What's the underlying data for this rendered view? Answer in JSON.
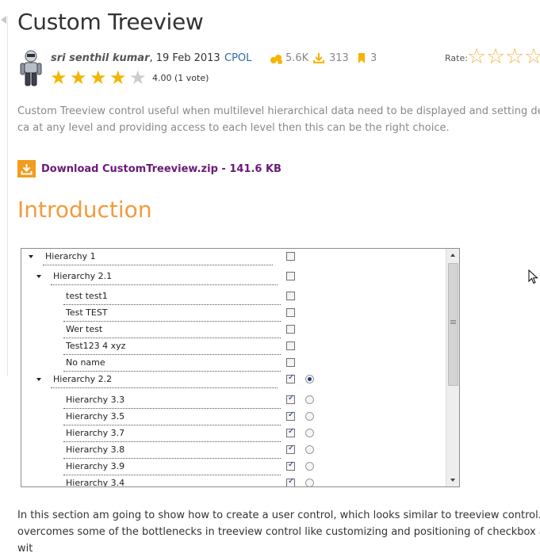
{
  "article": {
    "title": "Custom Treeview",
    "author": "sri senthil kumar",
    "date": ", 19 Feb 2013",
    "license": "CPOL",
    "views": "5.6K",
    "downloads": "313",
    "bookmarks": "3",
    "rating_score": "4.00 (1 vote)",
    "rating_value": 4,
    "rating_max": 5,
    "rate_label": "Rate:",
    "description": "Custom Treeview control useful when multilevel hierarchical data need to be displayed and setting default ca at any level and providing access to each level then this can be the right choice.",
    "download_label": "Download CustomTreeview.zip - 141.6 KB",
    "section_heading": "Introduction",
    "intro_paragraph": "In this section am going to show how to create a user control, which looks similar to treeview control. It overcomes some of the bottlenecks in treeview control like customizing and positioning of checkbox and wit"
  },
  "colors": {
    "accent_orange": "#f29b3d",
    "download_purple": "#6a1a78",
    "link_blue": "#2d6aa1",
    "star_gold": "#f4b400"
  },
  "treeview": {
    "rows": [
      {
        "label": "Hierarchy 1",
        "level": 0,
        "expander": true,
        "checked": false,
        "radio": null
      },
      {
        "label": "Hierarchy 2.1",
        "level": 1,
        "expander": true,
        "checked": false,
        "radio": null
      },
      {
        "label": "test test1",
        "level": 2,
        "expander": false,
        "checked": false,
        "radio": null
      },
      {
        "label": "Test TEST",
        "level": 2,
        "expander": false,
        "checked": false,
        "radio": null
      },
      {
        "label": "Wer test",
        "level": 2,
        "expander": false,
        "checked": false,
        "radio": null
      },
      {
        "label": "Test123 4 xyz",
        "level": 2,
        "expander": false,
        "checked": false,
        "radio": null
      },
      {
        "label": "No name",
        "level": 2,
        "expander": false,
        "checked": false,
        "radio": null
      },
      {
        "label": "Hierarchy 2.2",
        "level": 1,
        "expander": true,
        "checked": true,
        "radio": true
      },
      {
        "label": "Hierarchy 3.3",
        "level": 2,
        "expander": false,
        "checked": true,
        "radio": false
      },
      {
        "label": "Hierarchy 3.5",
        "level": 2,
        "expander": false,
        "checked": true,
        "radio": false
      },
      {
        "label": "Hierarchy 3.7",
        "level": 2,
        "expander": false,
        "checked": true,
        "radio": false
      },
      {
        "label": "Hierarchy 3.8",
        "level": 2,
        "expander": false,
        "checked": true,
        "radio": false
      },
      {
        "label": "Hierarchy 3.9",
        "level": 2,
        "expander": false,
        "checked": true,
        "radio": false
      },
      {
        "label": "Hierarchy 3.4",
        "level": 2,
        "expander": false,
        "checked": true,
        "radio": false
      }
    ]
  }
}
